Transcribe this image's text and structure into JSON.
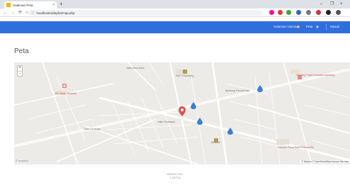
{
  "browser": {
    "tab_title": "Halaman Peta",
    "tab_close": "×",
    "new_tab": "+",
    "url": "localhost/u/depha/map.php",
    "window_controls": [
      "–",
      "❐",
      "×"
    ]
  },
  "navbar": {
    "dashboard": "Halaman Utama",
    "peta": "Peta",
    "user": "Masuk"
  },
  "page": {
    "title": "Peta"
  },
  "map": {
    "zoom_in": "+",
    "zoom_out": "-",
    "labels": {
      "place1": "RS Santa Perawati",
      "place2": "SMP 2 Bandung",
      "place3": "Gedung Pusat Konsultasi Bandung",
      "place4": "Bandung Permai Dulu",
      "place5": "Alfamart",
      "place6": "Kampus Pusat Bakti Dharma Eki",
      "street1": "Jalan Awul-Awul",
      "street2": "Jalan Sumbawa",
      "street3": "Jalan Kenanga"
    },
    "logo": "© mapbox",
    "attribution": "© Mapbox © OpenStreetMap Improve this map",
    "markers": [
      {
        "name": "marker-red",
        "color": "#d9534f"
      },
      {
        "name": "marker-blue",
        "color": "#3b7dd8"
      }
    ]
  },
  "footer": {
    "line1": "WEBGIS 2021",
    "line2": "© DEPHA"
  }
}
